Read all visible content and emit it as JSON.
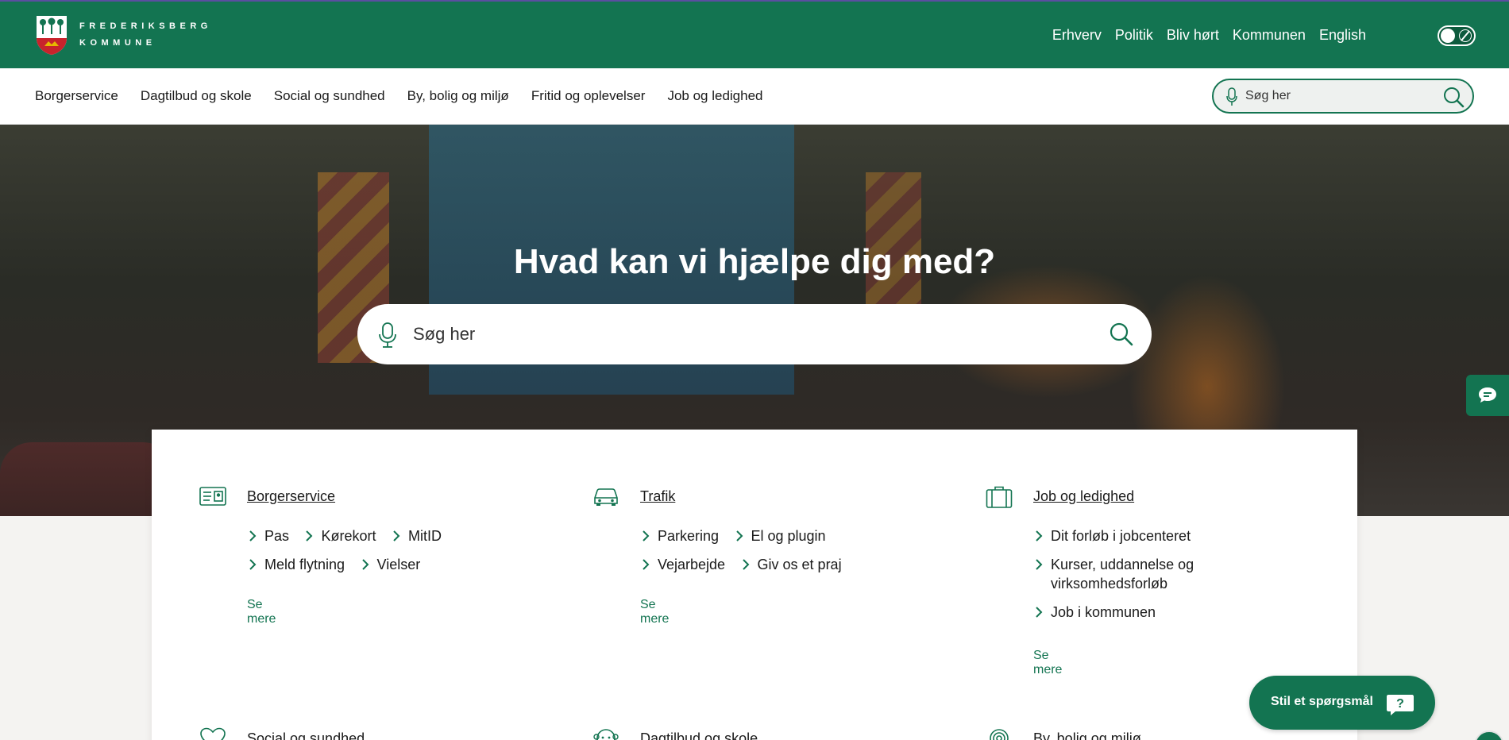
{
  "brand": {
    "line1": "FREDERIKSBERG",
    "line2": "KOMMUNE"
  },
  "util_nav": [
    "Erhverv",
    "Politik",
    "Bliv hørt",
    "Kommunen",
    "English"
  ],
  "main_nav": [
    "Borgerservice",
    "Dagtilbud og skole",
    "Social og sundhed",
    "By, bolig og miljø",
    "Fritid og oplevelser",
    "Job og ledighed"
  ],
  "nav_search": {
    "placeholder": "Søg her"
  },
  "hero": {
    "title": "Hvad kan vi hjælpe dig med?",
    "search_placeholder": "Søg her"
  },
  "columns": [
    {
      "title": "Borgerservice",
      "icon": "id-card-icon",
      "links": [
        "Pas",
        "Kørekort",
        "MitID",
        "Meld flytning",
        "Vielser"
      ],
      "more": "Se mere"
    },
    {
      "title": "Trafik",
      "icon": "car-icon",
      "links": [
        "Parkering",
        "El og plugin",
        "Vejarbejde",
        "Giv os et praj"
      ],
      "more": "Se mere"
    },
    {
      "title": "Job og ledighed",
      "icon": "briefcase-icon",
      "links": [
        "Dit forløb i jobcenteret",
        "Kurser, uddannelse og virksomhedsforløb",
        "Job i kommunen"
      ],
      "more": "Se mere"
    }
  ],
  "row2_titles": [
    "Social og sundhed",
    "Dagtilbud og skole",
    "By, bolig og miljø"
  ],
  "ask_button": {
    "label": "Stil et spørgsmål"
  },
  "colors": {
    "primary": "#137451",
    "page_bg": "#f4f3f1"
  }
}
